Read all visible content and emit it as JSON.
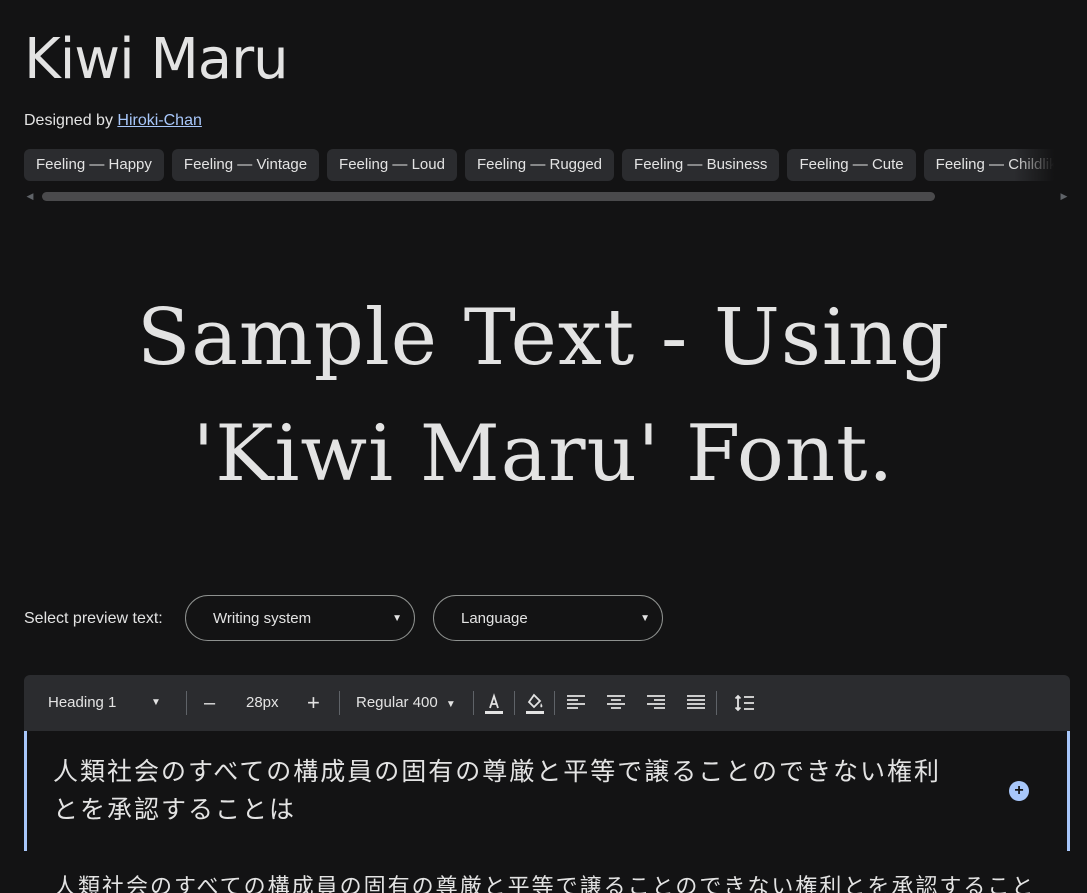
{
  "header": {
    "font_name": "Kiwi Maru",
    "designed_by_prefix": "Designed by ",
    "designer": "Hiroki-Chan"
  },
  "tags": [
    "Feeling — Happy",
    "Feeling — Vintage",
    "Feeling — Loud",
    "Feeling — Rugged",
    "Feeling — Business",
    "Feeling — Cute",
    "Feeling — Childlike"
  ],
  "sample": {
    "line1": "Sample Text - Using",
    "line2": "'Kiwi Maru' Font."
  },
  "preview_controls": {
    "label": "Select preview text:",
    "writing_system": "Writing system",
    "language": "Language"
  },
  "toolbar": {
    "style_select": "Heading 1",
    "decrease": "–",
    "font_size": "28px",
    "increase": "+",
    "weight_select": "Regular 400"
  },
  "editor": {
    "heading_text": "人類社会のすべての構成員の固有の尊厳と平等で譲ることのできない権利とを承認することは",
    "add_icon": "add-circle-icon"
  },
  "preview_next_line": "人類社会のすべての構成員の固有の尊厳と平等で譲ることのできない権利とを承認すること",
  "colors": {
    "background": "#131314",
    "surface": "#2b2c2f",
    "accent": "#a8c7fa",
    "text": "#e3e3e3"
  }
}
